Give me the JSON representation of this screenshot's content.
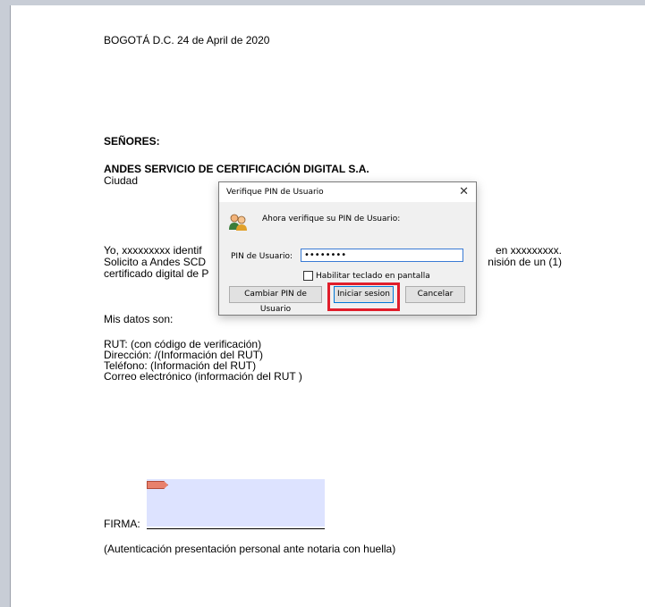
{
  "document": {
    "date_line": "BOGOTÁ D.C.  24 de April de 2020",
    "salutation": "SEÑORES:",
    "company": "ANDES SERVICIO DE CERTIFICACIÓN DIGITAL S.A.",
    "city": "Ciudad",
    "para_line1_left": "Yo, xxxxxxxxx identif",
    "para_line1_right": "en xxxxxxxxx.",
    "para_line2_left": "Solicito a Andes SCD",
    "para_line2_right": "nisión de un (1)",
    "para_line3_left": "certificado digital de P",
    "data_intro": "Mis datos son:",
    "rut": "RUT: (con código de verificación)",
    "address": "Dirección: /(Información del RUT)",
    "phone": "Teléfono: (Información del RUT)",
    "email": "Correo electrónico (información del RUT )",
    "signature_label": "FIRMA:",
    "auth_note": "(Autenticación presentación personal ante notaria con huella)"
  },
  "dialog": {
    "title": "Verifique PIN de Usuario",
    "prompt": "Ahora verifique su PIN de Usuario:",
    "pin_label": "PIN de Usuario:",
    "pin_value": "••••••••",
    "virtual_keyboard_label": "Habilitar teclado en pantalla",
    "virtual_keyboard_checked": false,
    "change_pin_button": "Cambiar PIN de Usuario",
    "login_button": "Iniciar sesion",
    "cancel_button": "Cancelar",
    "close_symbol": "✕"
  },
  "colors": {
    "highlight": "#e01e2b",
    "signature_box": "#dde3ff",
    "focus_border": "#0078d7"
  }
}
